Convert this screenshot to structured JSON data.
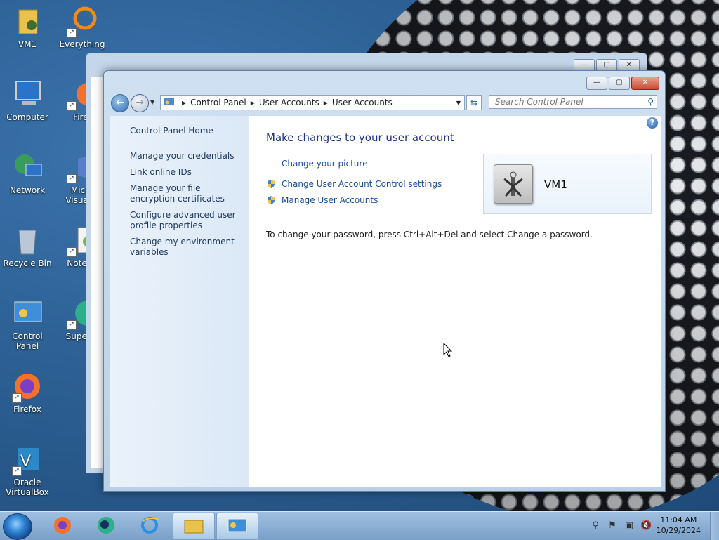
{
  "desktop": {
    "icons": [
      {
        "label": "VM1"
      },
      {
        "label": "Everything"
      },
      {
        "label": "Computer"
      },
      {
        "label": "Firef"
      },
      {
        "label": "Network"
      },
      {
        "label": "Micro\nVisual S"
      },
      {
        "label": "Recycle Bin"
      },
      {
        "label": "Notepa"
      },
      {
        "label": "Control Panel"
      },
      {
        "label": "Superm"
      },
      {
        "label": "Firefox"
      },
      {
        "label": "Oracle VirtualBox"
      }
    ]
  },
  "window": {
    "address": {
      "crumbs": [
        "Control Panel",
        "User Accounts",
        "User Accounts"
      ]
    },
    "search_placeholder": "Search Control Panel",
    "left_pane": {
      "home": "Control Panel Home",
      "links": [
        "Manage your credentials",
        "Link online IDs",
        "Manage your file encryption certificates",
        "Configure advanced user profile properties",
        "Change my environment variables"
      ]
    },
    "main": {
      "heading": "Make changes to your user account",
      "tasks": [
        "Change your picture",
        "Change User Account Control settings",
        "Manage User Accounts"
      ],
      "user_name": "VM1",
      "password_note": "To change your password, press Ctrl+Alt+Del and select Change a password."
    }
  },
  "taskbar": {
    "clock_time": "11:04 AM",
    "clock_date": "10/29/2024"
  },
  "colors": {
    "link": "#1a4ea0",
    "heading": "#1e3287",
    "accent": "#2e6bb1"
  }
}
